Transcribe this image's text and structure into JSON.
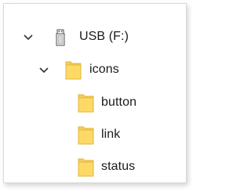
{
  "tree": {
    "drive": {
      "label": "USB (F:)",
      "icon": "usb-drive-icon",
      "expanded": true
    },
    "folder": {
      "label": "icons",
      "icon": "folder-icon",
      "expanded": true
    },
    "children": [
      {
        "label": "button",
        "icon": "folder-icon"
      },
      {
        "label": "link",
        "icon": "folder-icon"
      },
      {
        "label": "status",
        "icon": "folder-icon"
      }
    ]
  },
  "colors": {
    "folder_body": "#f9e08c",
    "folder_front": "#ffd966",
    "folder_edge": "#e2b53a",
    "chevron": "#333333",
    "text": "#1a1a1a"
  }
}
